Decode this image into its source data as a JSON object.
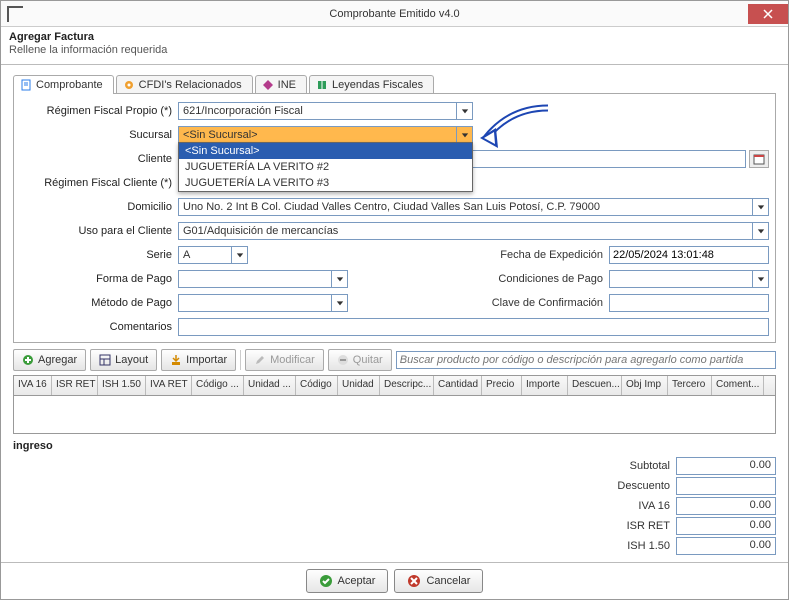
{
  "window": {
    "title": "Comprobante Emitido v4.0"
  },
  "header": {
    "title": "Agregar Factura",
    "subtitle": "Rellene la información requerida"
  },
  "tabs": [
    {
      "label": "Comprobante",
      "icon": "doc"
    },
    {
      "label": "CFDI's Relacionados",
      "icon": "gear"
    },
    {
      "label": "INE",
      "icon": "diamond"
    },
    {
      "label": "Leyendas Fiscales",
      "icon": "book"
    }
  ],
  "form": {
    "regimen_fiscal_propio": {
      "label": "Régimen Fiscal Propio (*)",
      "value": "621/Incorporación Fiscal"
    },
    "sucursal": {
      "label": "Sucursal",
      "value": "<Sin Sucursal>",
      "options": [
        "<Sin Sucursal>",
        "JUGUETERÍA LA VERITO #2",
        "JUGUETERÍA LA VERITO #3"
      ]
    },
    "cliente": {
      "label": "Cliente",
      "value": ""
    },
    "regimen_fiscal_cliente": {
      "label": "Régimen Fiscal Cliente (*)",
      "value": ""
    },
    "domicilio": {
      "label": "Domicilio",
      "value": "Uno No. 2 Int B Col. Ciudad Valles Centro, Ciudad Valles San Luis Potosí, C.P. 79000"
    },
    "uso_para_cliente": {
      "label": "Uso para el Cliente",
      "value": "G01/Adquisición de mercancías"
    },
    "serie": {
      "label": "Serie",
      "value": "A"
    },
    "fecha_expedicion": {
      "label": "Fecha de Expedición",
      "value": "22/05/2024 13:01:48"
    },
    "forma_pago": {
      "label": "Forma de Pago",
      "value": ""
    },
    "condiciones_pago": {
      "label": "Condiciones de Pago",
      "value": ""
    },
    "metodo_pago": {
      "label": "Método de Pago",
      "value": ""
    },
    "clave_confirmacion": {
      "label": "Clave de Confirmación",
      "value": ""
    },
    "comentarios": {
      "label": "Comentarios",
      "value": ""
    }
  },
  "toolbar": {
    "agregar": "Agregar",
    "layout": "Layout",
    "importar": "Importar",
    "modificar": "Modificar",
    "quitar": "Quitar",
    "search_placeholder": "Buscar producto por código o descripción para agregarlo como partida"
  },
  "grid_cols": [
    "IVA 16",
    "ISR RET",
    "ISH 1.50",
    "IVA RET",
    "Código ...",
    "Unidad ...",
    "Código",
    "Unidad",
    "Descripc...",
    "Cantidad",
    "Precio",
    "Importe",
    "Descuen...",
    "Obj Imp",
    "Tercero",
    "Coment..."
  ],
  "totals": {
    "ingreso_label": "ingreso",
    "rows": [
      {
        "label": "Subtotal",
        "value": "0.00"
      },
      {
        "label": "Descuento",
        "value": ""
      },
      {
        "label": "IVA 16",
        "value": "0.00"
      },
      {
        "label": "ISR RET",
        "value": "0.00"
      },
      {
        "label": "ISH 1.50",
        "value": "0.00"
      }
    ]
  },
  "footer": {
    "aceptar": "Aceptar",
    "cancelar": "Cancelar"
  }
}
